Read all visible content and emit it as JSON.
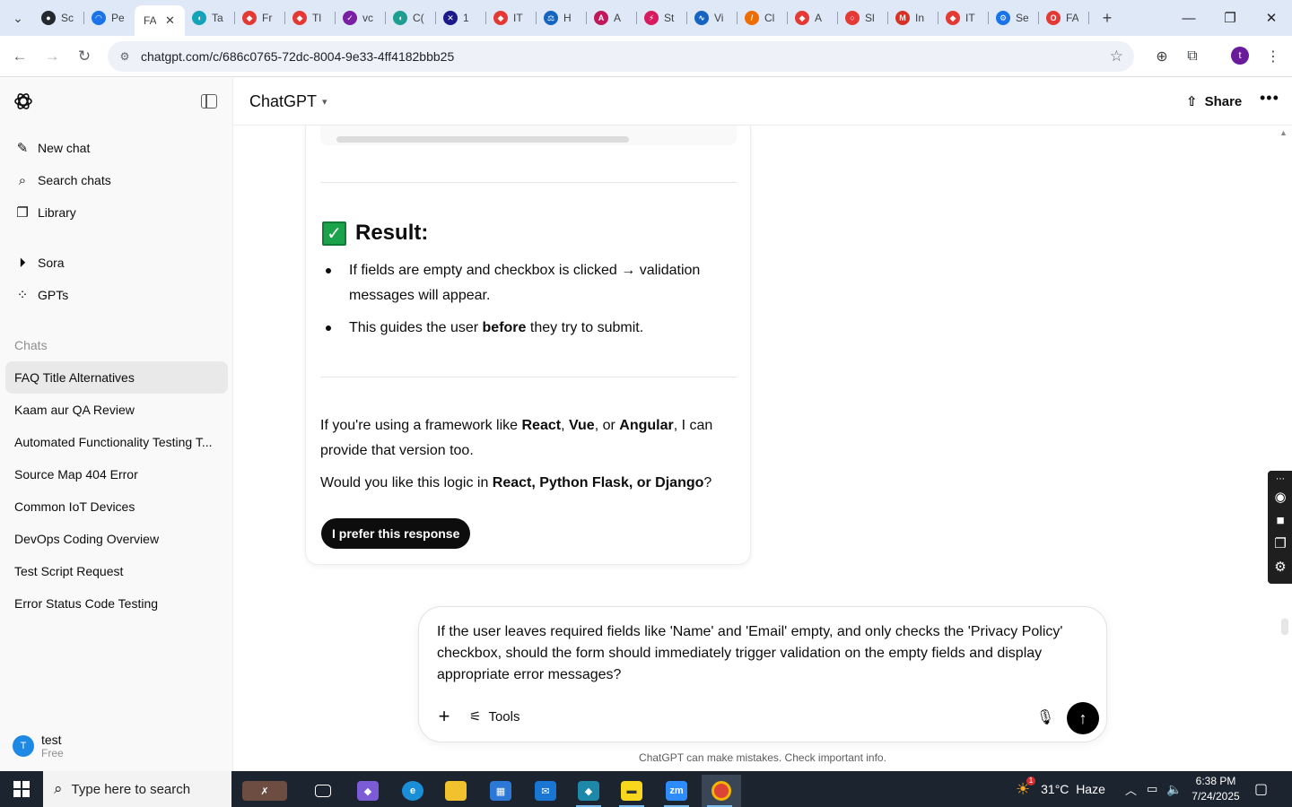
{
  "browser": {
    "tabs": [
      {
        "title": "Sc",
        "icon": "github-icon",
        "color": "#24292f"
      },
      {
        "title": "Pe",
        "icon": "speed-icon",
        "color": "#1a73e8"
      },
      {
        "title": "FA",
        "icon": "chatgpt-icon",
        "color": "#0d0d0d",
        "active": true
      },
      {
        "title": "Ta",
        "icon": "teal-icon",
        "color": "#14a3b8"
      },
      {
        "title": "Fr",
        "icon": "diamond-icon",
        "color": "#e53935"
      },
      {
        "title": "Tl",
        "icon": "diamond-icon",
        "color": "#e53935"
      },
      {
        "title": "vc",
        "icon": "check-icon",
        "color": "#7b1fa2"
      },
      {
        "title": "C(",
        "icon": "teal-icon",
        "color": "#1e9e8f"
      },
      {
        "title": "1",
        "icon": "x-icon",
        "color": "#1a1a8c"
      },
      {
        "title": "IT",
        "icon": "diamond-icon",
        "color": "#e53935"
      },
      {
        "title": "H",
        "icon": "scale-icon",
        "color": "#1565c0"
      },
      {
        "title": "A",
        "icon": "a-icon",
        "color": "#c2185b"
      },
      {
        "title": "St",
        "icon": "bolt-icon",
        "color": "#d81b60"
      },
      {
        "title": "Vi",
        "icon": "wave-icon",
        "color": "#1565c0"
      },
      {
        "title": "Cl",
        "icon": "slash-icon",
        "color": "#ef6c00"
      },
      {
        "title": "A",
        "icon": "diamond-icon",
        "color": "#e53935"
      },
      {
        "title": "Sl",
        "icon": "ring-icon",
        "color": "#e53935"
      },
      {
        "title": "In",
        "icon": "gmail-icon",
        "color": "#d93025"
      },
      {
        "title": "IT",
        "icon": "diamond-icon",
        "color": "#e53935"
      },
      {
        "title": "Se",
        "icon": "gear-icon",
        "color": "#1a73e8"
      },
      {
        "title": "FA",
        "icon": "opera-icon",
        "color": "#e53935"
      }
    ],
    "new_tab_label": "+",
    "url": "chatgpt.com/c/686c0765-72dc-8004-9e33-4ff4182bbb25",
    "profile_initial": "t"
  },
  "sidebar": {
    "primary": [
      {
        "label": "New chat",
        "icon": "new-chat-icon"
      },
      {
        "label": "Search chats",
        "icon": "search-icon"
      },
      {
        "label": "Library",
        "icon": "library-icon"
      }
    ],
    "secondary": [
      {
        "label": "Sora",
        "icon": "play-circle-icon"
      },
      {
        "label": "GPTs",
        "icon": "grid-icon"
      }
    ],
    "chats_heading": "Chats",
    "chats": [
      {
        "label": "FAQ Title Alternatives",
        "active": true
      },
      {
        "label": "Kaam aur QA Review"
      },
      {
        "label": "Automated Functionality Testing T..."
      },
      {
        "label": "Source Map 404 Error"
      },
      {
        "label": "Common IoT Devices"
      },
      {
        "label": "DevOps Coding Overview"
      },
      {
        "label": "Test Script Request"
      },
      {
        "label": "Error Status Code Testing"
      }
    ],
    "user": {
      "initial": "T",
      "name": "test",
      "plan": "Free"
    }
  },
  "header": {
    "model": "ChatGPT",
    "share_label": "Share"
  },
  "response": {
    "result_heading": "Result:",
    "bullets": [
      {
        "pre": "If fields are empty and checkbox is clicked → validation messages will appear.",
        "bold": "",
        "post": ""
      },
      {
        "pre": "This guides the user ",
        "bold": "before",
        "post": " they try to submit."
      }
    ],
    "para1": {
      "t1": "If you're using a framework like ",
      "b1": "React",
      "t2": ", ",
      "b2": "Vue",
      "t3": ", or ",
      "b3": "Angular",
      "t4": ", I can provide that version too."
    },
    "para2": {
      "t1": "Would you like this logic in ",
      "b1": "React, Python Flask, or Django",
      "t2": "?"
    },
    "prefer_label": "I prefer this response"
  },
  "composer": {
    "text": "If the user leaves required fields like 'Name' and 'Email' empty, and only checks the 'Privacy Policy' checkbox, should the form should immediately trigger validation on the empty fields and display appropriate error messages?",
    "tools_label": "Tools"
  },
  "disclaimer": "ChatGPT can make mistakes. Check important info.",
  "taskbar": {
    "search_placeholder": "Type here to search",
    "weather": "31°C  Haze",
    "time": "6:38 PM",
    "date": "7/24/2025",
    "weather_badge": "1"
  },
  "colors": {
    "accent": "#0d0d0d",
    "taskbar": "#1c2430",
    "check_green": "#1aa34a"
  }
}
